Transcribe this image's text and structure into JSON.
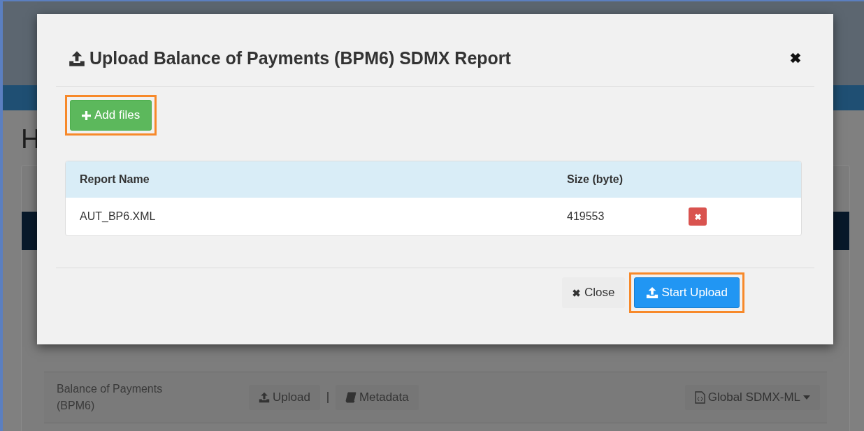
{
  "background_page": {
    "heading": "H",
    "rows": [
      {
        "name": "Balance of Payments (BPM6)",
        "actions": [
          {
            "kind": "upload",
            "label": "Upload"
          },
          {
            "kind": "metadata",
            "label": "Metadata"
          }
        ],
        "format": "Global SDMX-ML"
      }
    ]
  },
  "modal": {
    "title": "Upload Balance of Payments (BPM6) SDMX Report",
    "add_button": {
      "label": "Add files",
      "highlighted": true
    },
    "table": {
      "columns": [
        "Report Name",
        "Size (byte)"
      ],
      "rows": [
        {
          "name": "AUT_BP6.XML",
          "size": "419553"
        }
      ]
    },
    "footer": [
      {
        "kind": "close",
        "label": "Close",
        "highlighted": false
      },
      {
        "kind": "upload",
        "label": "Start Upload",
        "highlighted": true
      }
    ]
  }
}
